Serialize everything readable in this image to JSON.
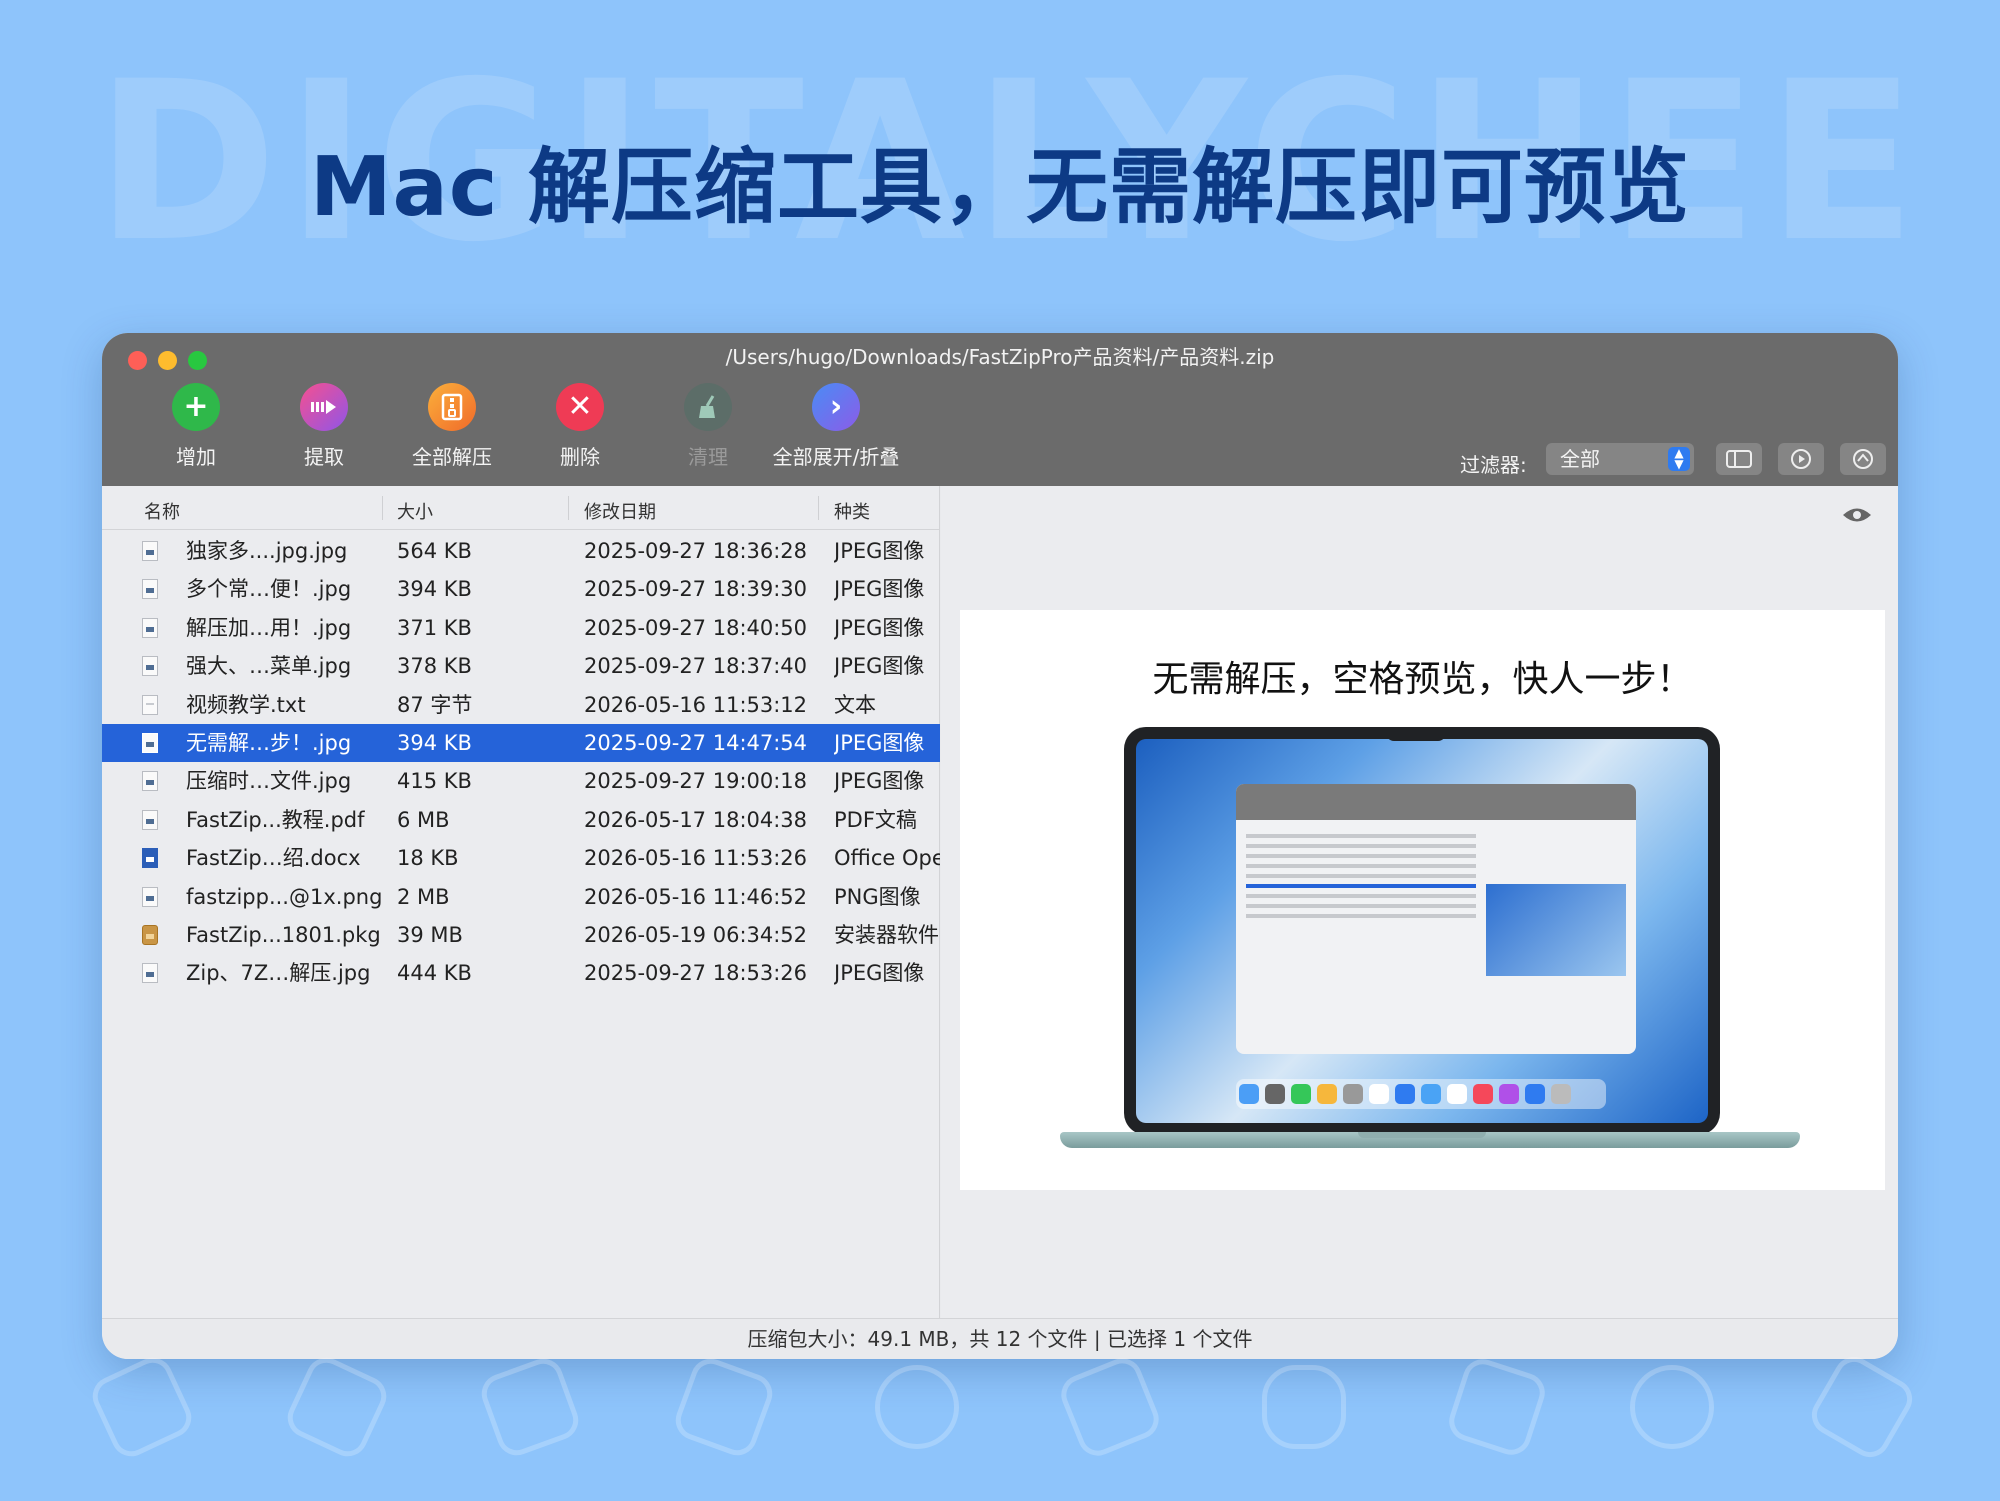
{
  "watermark": "DIGITALYCHEE",
  "headline": "Mac 解压缩工具，无需解压即可预览",
  "window": {
    "title": "/Users/hugo/Downloads/FastZipPro产品资料/产品资料.zip"
  },
  "toolbar": {
    "add": "增加",
    "extract": "提取",
    "extract_all": "全部解压",
    "delete": "删除",
    "clean": "清理",
    "expand_collapse": "全部展开/折叠",
    "filter_label": "过滤器:",
    "filter_value": "全部"
  },
  "columns": {
    "name": "名称",
    "size": "大小",
    "date": "修改日期",
    "kind": "种类"
  },
  "files": [
    {
      "name": "独家多....jpg.jpg",
      "size": "564 KB",
      "date": "2025-09-27 18:36:28",
      "kind": "JPEG图像",
      "icon": "image"
    },
    {
      "name": "多个常…便！.jpg",
      "size": "394 KB",
      "date": "2025-09-27 18:39:30",
      "kind": "JPEG图像",
      "icon": "image"
    },
    {
      "name": "解压加…用！.jpg",
      "size": "371 KB",
      "date": "2025-09-27 18:40:50",
      "kind": "JPEG图像",
      "icon": "image"
    },
    {
      "name": "强大、…菜单.jpg",
      "size": "378 KB",
      "date": "2025-09-27 18:37:40",
      "kind": "JPEG图像",
      "icon": "image"
    },
    {
      "name": "视频教学.txt",
      "size": "87 字节",
      "date": "2026-05-16 11:53:12",
      "kind": "文本",
      "icon": "text"
    },
    {
      "name": "无需解…步！.jpg",
      "size": "394 KB",
      "date": "2025-09-27 14:47:54",
      "kind": "JPEG图像",
      "icon": "image",
      "selected": true
    },
    {
      "name": "压缩时…文件.jpg",
      "size": "415 KB",
      "date": "2025-09-27 19:00:18",
      "kind": "JPEG图像",
      "icon": "image"
    },
    {
      "name": "FastZip...教程.pdf",
      "size": "6 MB",
      "date": "2026-05-17 18:04:38",
      "kind": "PDF文稿",
      "icon": "image"
    },
    {
      "name": "FastZip…绍.docx",
      "size": "18 KB",
      "date": "2026-05-16 11:53:26",
      "kind": "Office Ope",
      "icon": "doc"
    },
    {
      "name": "fastzipp...@1x.png",
      "size": "2 MB",
      "date": "2026-05-16 11:46:52",
      "kind": "PNG图像",
      "icon": "image"
    },
    {
      "name": "FastZip...1801.pkg",
      "size": "39 MB",
      "date": "2026-05-19 06:34:52",
      "kind": "安装器软件",
      "icon": "pkg"
    },
    {
      "name": "Zip、7Z…解压.jpg",
      "size": "444 KB",
      "date": "2025-09-27 18:53:26",
      "kind": "JPEG图像",
      "icon": "image"
    }
  ],
  "preview": {
    "caption": "无需解压，空格预览，快人一步！"
  },
  "status": "压缩包大小：49.1 MB，共 12 个文件   |   已选择 1 个文件"
}
